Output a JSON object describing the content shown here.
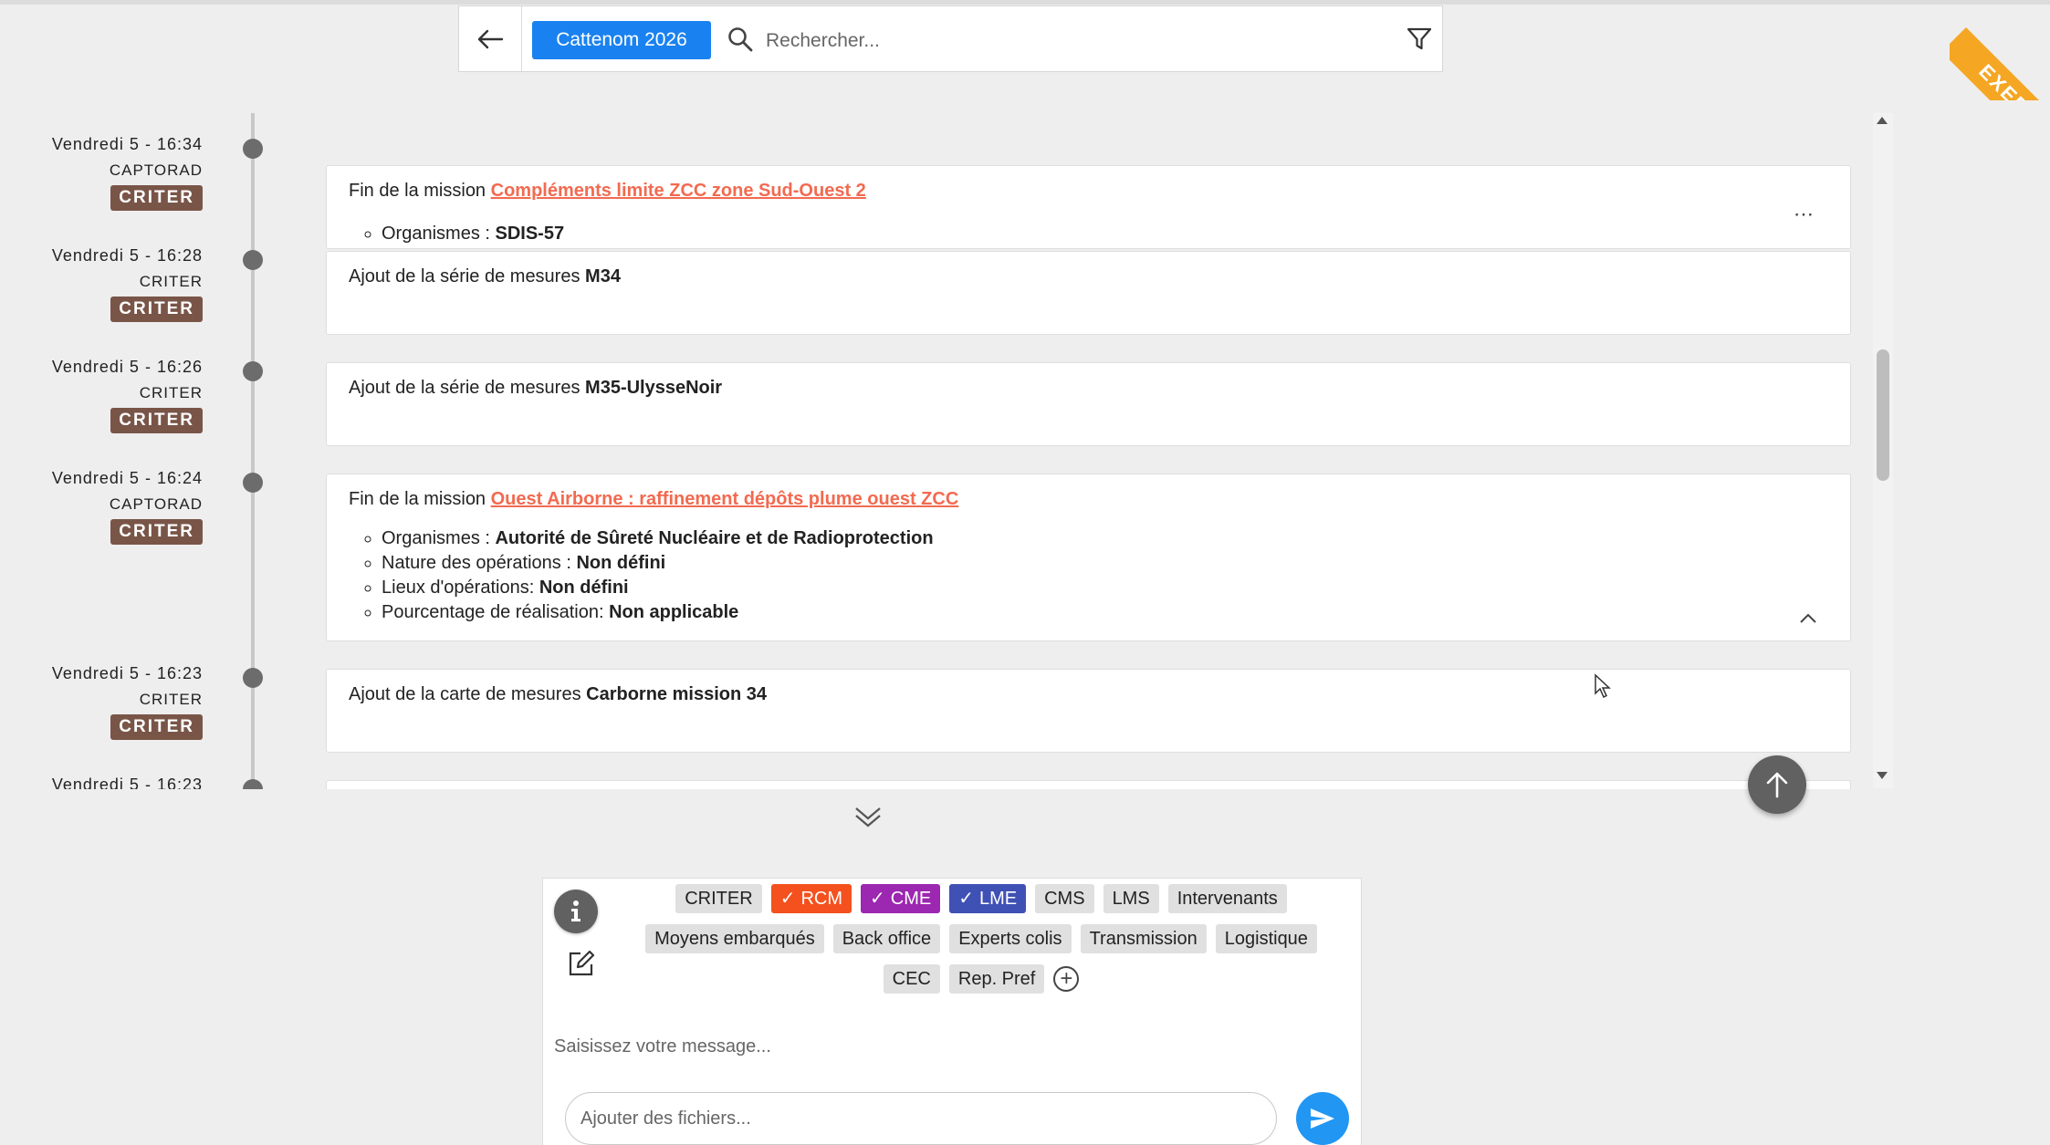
{
  "header": {
    "event_label": "Cattenom 2026",
    "search_placeholder": "Rechercher..."
  },
  "ribbon": {
    "text": "EXERCICE"
  },
  "timeline": [
    {
      "date": "Vendredi 5 - 16:34",
      "source": "CAPTORAD",
      "badge": "CRITER",
      "prefix": "Fin de la mission ",
      "link": "Compléments limite ZCC zone Sud-Ouest 2",
      "details": [
        {
          "label": "Organismes : ",
          "value": "SDIS-57"
        }
      ]
    },
    {
      "date": "Vendredi 5 - 16:28",
      "source": "CRITER",
      "badge": "CRITER",
      "prefix": "Ajout de la série de mesures ",
      "bold": "M34"
    },
    {
      "date": "Vendredi 5 - 16:26",
      "source": "CRITER",
      "badge": "CRITER",
      "prefix": "Ajout de la série de mesures ",
      "bold": "M35-UlysseNoir"
    },
    {
      "date": "Vendredi 5 - 16:24",
      "source": "CAPTORAD",
      "badge": "CRITER",
      "prefix": "Fin de la mission ",
      "link": "Ouest Airborne : raffinement dépôts plume ouest ZCC",
      "details": [
        {
          "label": "Organismes : ",
          "value": "Autorité de Sûreté Nucléaire et de Radioprotection"
        },
        {
          "label": "Nature des opérations : ",
          "value": "Non défini"
        },
        {
          "label": "Lieux d'opérations: ",
          "value": "Non défini"
        },
        {
          "label": "Pourcentage de réalisation: ",
          "value": "Non applicable"
        }
      ]
    },
    {
      "date": "Vendredi 5 - 16:23",
      "source": "CRITER",
      "badge": "CRITER",
      "prefix": "Ajout de la carte de mesures ",
      "bold": "Carborne mission 34"
    },
    {
      "date": "Vendredi 5 - 16:23"
    }
  ],
  "composer": {
    "tag_rows": [
      [
        {
          "label": "CRITER",
          "checked": false
        },
        {
          "label": "RCM",
          "checked": true,
          "color": "#f4511e"
        },
        {
          "label": "CME",
          "checked": true,
          "color": "#9c27b0"
        },
        {
          "label": "LME",
          "checked": true,
          "color": "#3f51b5"
        },
        {
          "label": "CMS",
          "checked": false
        },
        {
          "label": "LMS",
          "checked": false
        },
        {
          "label": "Intervenants",
          "checked": false
        }
      ],
      [
        {
          "label": "Moyens embarqués",
          "checked": false
        },
        {
          "label": "Back office",
          "checked": false
        },
        {
          "label": "Experts colis",
          "checked": false
        },
        {
          "label": "Transmission",
          "checked": false
        },
        {
          "label": "Logistique",
          "checked": false
        }
      ],
      [
        {
          "label": "CEC",
          "checked": false
        },
        {
          "label": "Rep. Pref",
          "checked": false
        }
      ]
    ],
    "message_placeholder": "Saisissez votre message...",
    "files_placeholder": "Ajouter des fichiers..."
  }
}
